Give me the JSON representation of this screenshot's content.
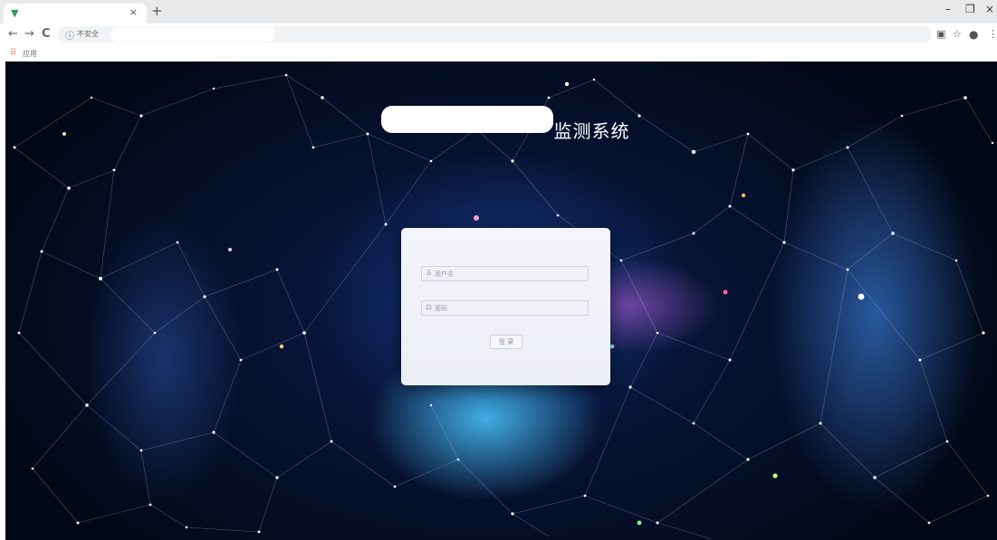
{
  "browser": {
    "tab": {
      "favicon": "vue-logo-icon",
      "close_glyph": "×"
    },
    "new_tab_glyph": "+",
    "window_controls": {
      "minimize": "–",
      "restore": "❐",
      "close": "×"
    },
    "nav": {
      "back": "←",
      "forward": "→",
      "reload": "C"
    },
    "address_bar": {
      "security_label": "不安全"
    },
    "bookmarks": {
      "apps_label": "应用"
    }
  },
  "page": {
    "title_suffix": "监测系统"
  },
  "login": {
    "username_placeholder": "用户名",
    "password_placeholder": "密码",
    "submit_label": "登 录"
  },
  "colors": {
    "space_dark": "#030817",
    "space_blue": "#163a84",
    "nebula_cyan": "#4ac5ff",
    "nebula_pink": "#dc6eff",
    "card_bg": "#eceef6"
  }
}
